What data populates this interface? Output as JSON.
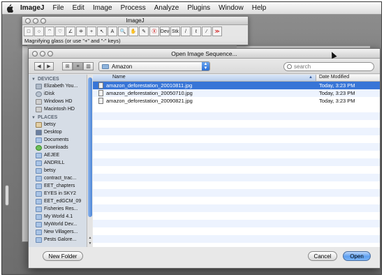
{
  "menubar": {
    "app": "ImageJ",
    "items": [
      "File",
      "Edit",
      "Image",
      "Process",
      "Analyze",
      "Plugins",
      "Window",
      "Help"
    ]
  },
  "imagej_window": {
    "title": "ImageJ",
    "status": "Magnifying glass (or use \"+\" and \"-\" keys)",
    "tools": [
      "rectangle-icon",
      "oval-icon",
      "polygon-icon",
      "freehand-icon",
      "line-icon",
      "angle-icon",
      "point-icon",
      "wand-icon",
      "text-icon",
      "magnifier-icon",
      "hand-icon",
      "dropper-icon",
      "x-icon",
      "dev-icon",
      "stk-icon",
      "pencil-icon",
      "brush-icon",
      "picker-icon",
      "more-icon"
    ],
    "tool_glyphs": [
      "□",
      "○",
      "⌔",
      "♡",
      "∠",
      "⁜",
      "+",
      "↖",
      "A",
      "🔍",
      "✋",
      "✎",
      "Ⓧ",
      "Dev",
      "Stk",
      "/",
      "ℓ",
      "⁄",
      "≫"
    ]
  },
  "dialog": {
    "title": "Open Image Sequence...",
    "location": "Amazon",
    "search_placeholder": "search",
    "columns": {
      "name": "Name",
      "date": "Date Modified"
    },
    "files": [
      {
        "name": "amazon_deforestation_20010811.jpg",
        "date": "Today, 3:23 PM",
        "selected": true
      },
      {
        "name": "amazon_deforestation_20050710.jpg",
        "date": "Today, 3:23 PM",
        "selected": false
      },
      {
        "name": "amazon_deforestation_20090821.jpg",
        "date": "Today, 3:23 PM",
        "selected": false
      }
    ],
    "sidebar": {
      "devices_header": "DEVICES",
      "devices": [
        {
          "label": "Elizabeth You...",
          "icon": "computer-icon"
        },
        {
          "label": "iDisk",
          "icon": "idisk-icon"
        },
        {
          "label": "Windows HD",
          "icon": "disk-icon"
        },
        {
          "label": "Macintosh HD",
          "icon": "disk-icon"
        }
      ],
      "places_header": "PLACES",
      "places": [
        {
          "label": "betsy",
          "icon": "home-icon"
        },
        {
          "label": "Desktop",
          "icon": "desktop-icon"
        },
        {
          "label": "Documents",
          "icon": "folder-icon"
        },
        {
          "label": "Downloads",
          "icon": "downloads-icon"
        },
        {
          "label": "AEJEE",
          "icon": "folder-icon"
        },
        {
          "label": "ANDRILL",
          "icon": "folder-icon"
        },
        {
          "label": "betsy",
          "icon": "folder-icon"
        },
        {
          "label": "contract_trac...",
          "icon": "folder-icon"
        },
        {
          "label": "EET_chapters",
          "icon": "folder-icon"
        },
        {
          "label": "EYES in SKY2",
          "icon": "folder-icon"
        },
        {
          "label": "EET_edGCM_09",
          "icon": "folder-icon"
        },
        {
          "label": "Fisheries Res...",
          "icon": "folder-icon"
        },
        {
          "label": "My World 4.1",
          "icon": "folder-icon"
        },
        {
          "label": "MyWorld Dev...",
          "icon": "folder-icon"
        },
        {
          "label": "New Villagers...",
          "icon": "folder-icon"
        },
        {
          "label": "Pests Galore...",
          "icon": "folder-icon"
        }
      ]
    },
    "buttons": {
      "new_folder": "New Folder",
      "cancel": "Cancel",
      "open": "Open"
    }
  }
}
